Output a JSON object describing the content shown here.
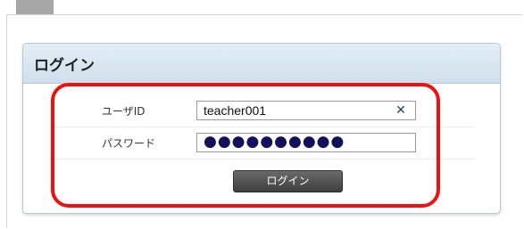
{
  "panel": {
    "title": "ログイン"
  },
  "form": {
    "user_label": "ユーザID",
    "user_value": "teacher001",
    "password_label": "パスワード",
    "password_mask": "●●●●●●●●●●",
    "login_button": "ログイン"
  },
  "icons": {
    "clear": "close-icon"
  },
  "colors": {
    "highlight": "#ee1111",
    "header_bg": "#d8e6f1",
    "button_bg": "#4f4f4f"
  }
}
